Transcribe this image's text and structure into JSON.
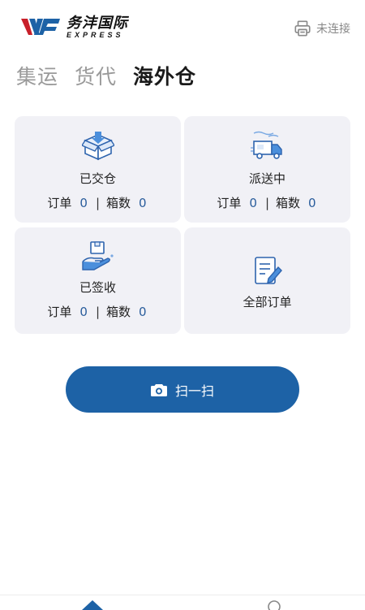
{
  "brand": {
    "name_cn": "务沣国际",
    "name_en": "EXPRESS",
    "accent": "#c8202a",
    "primary": "#1d62a6"
  },
  "printer": {
    "status": "未连接",
    "icon": "printer-icon"
  },
  "tabs": [
    {
      "label": "集运",
      "active": false
    },
    {
      "label": "货代",
      "active": false
    },
    {
      "label": "海外仓",
      "active": true
    }
  ],
  "cards": {
    "delivered": {
      "title": "已交仓",
      "icon": "box-icon",
      "order_label": "订单",
      "order_count": "0",
      "box_label": "箱数",
      "box_count": "0"
    },
    "shipping": {
      "title": "派送中",
      "icon": "delivery-truck-icon",
      "order_label": "订单",
      "order_count": "0",
      "box_label": "箱数",
      "box_count": "0"
    },
    "signed": {
      "title": "已签收",
      "icon": "hand-package-icon",
      "order_label": "订单",
      "order_count": "0",
      "box_label": "箱数",
      "box_count": "0"
    },
    "all_orders": {
      "title": "全部订单",
      "icon": "document-edit-icon"
    }
  },
  "scan_button": {
    "label": "扫一扫",
    "icon": "camera-icon"
  },
  "bottom_nav": [
    {
      "icon": "home-icon"
    },
    {
      "icon": "profile-icon"
    }
  ]
}
